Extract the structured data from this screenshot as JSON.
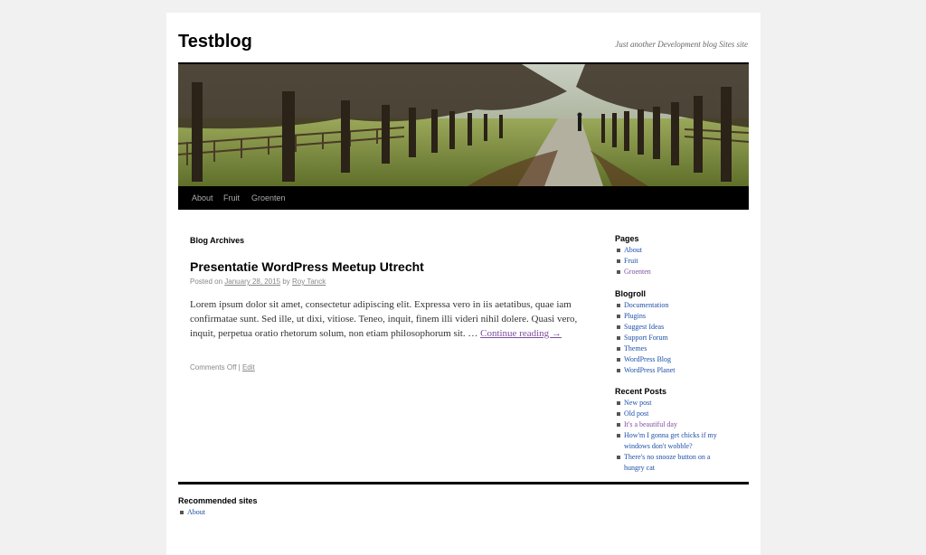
{
  "site": {
    "title": "Testblog",
    "description": "Just another Development blog Sites site"
  },
  "nav": {
    "items": [
      "About",
      "Fruit",
      "Groenten"
    ]
  },
  "archive": {
    "title": "Blog Archives"
  },
  "post": {
    "title": "Presentatie WordPress Meetup Utrecht",
    "meta_prefix": "Posted on",
    "date": "January 28, 2015",
    "meta_by": "by",
    "author": "Roy Tanck",
    "excerpt": "Lorem ipsum dolor sit amet, consectetur adipiscing elit. Expressa vero in iis aetatibus, quae iam confirmatae sunt. Sed ille, ut dixi, vitiose. Teneo, inquit, finem illi videri nihil dolere. Quasi vero, inquit, perpetua oratio rhetorum solum, non etiam philosophorum sit. …",
    "continue_label": "Continue reading →",
    "comments": "Comments Off",
    "separator": "|",
    "edit_label": "Edit"
  },
  "sidebar": {
    "pages": {
      "heading": "Pages",
      "items": [
        "About",
        "Fruit",
        "Groenten"
      ]
    },
    "blogroll": {
      "heading": "Blogroll",
      "items": [
        "Documentation",
        "Plugins",
        "Suggest Ideas",
        "Support Forum",
        "Themes",
        "WordPress Blog",
        "WordPress Planet"
      ]
    },
    "recent": {
      "heading": "Recent Posts",
      "items": [
        "New post",
        "Old post",
        "It's a beautiful day",
        "How'm I gonna get chicks if my windows don't wobble?",
        "There's no snooze button on a hungry cat"
      ]
    }
  },
  "footer": {
    "heading": "Recommended sites",
    "items": [
      "About"
    ]
  },
  "colors": {
    "background": "#f1f1f1",
    "nav_bar": "#000000",
    "link": "#1c4fa8",
    "visited_link": "#7e4f9e"
  }
}
